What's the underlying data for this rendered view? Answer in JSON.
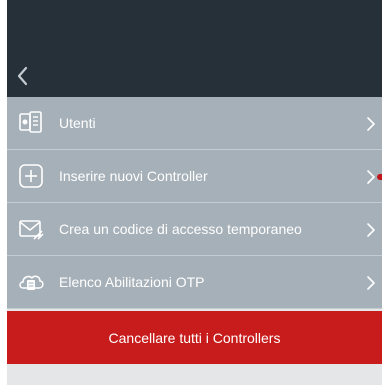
{
  "colors": {
    "nav_bg": "#253039",
    "list_bg": "#a6b0b8",
    "danger_bg": "#c81c1c",
    "footer_bg": "#e4e6e8",
    "accent_dot": "#c0161a"
  },
  "nav": {
    "back_icon": "chevron-left-icon"
  },
  "menu": {
    "items": [
      {
        "label": "Utenti",
        "icon": "users-list-icon"
      },
      {
        "label": "Inserire nuovi Controller",
        "icon": "plus-square-icon"
      },
      {
        "label": "Crea un codice di accesso temporaneo",
        "icon": "envelope-icon"
      },
      {
        "label": "Elenco Abilitazioni OTP",
        "icon": "cloud-list-icon"
      }
    ]
  },
  "actions": {
    "delete_all_label": "Cancellare tutti i Controllers"
  }
}
